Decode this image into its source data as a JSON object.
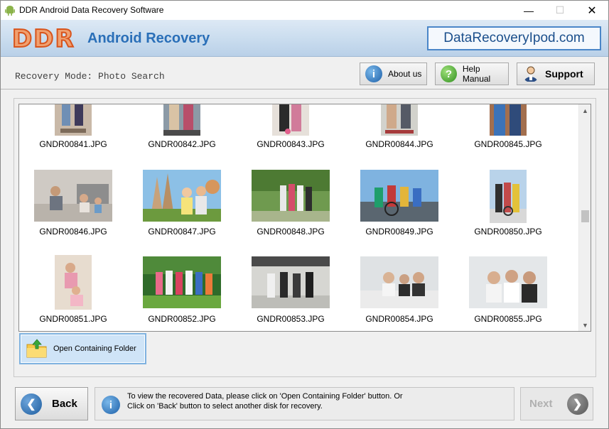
{
  "window": {
    "title": "DDR Android Data Recovery Software",
    "minimize": "—",
    "maximize": "☐",
    "close": "✕"
  },
  "banner": {
    "logo": "DDR",
    "app_name": "Android Recovery",
    "website": "DataRecoveryIpod.com"
  },
  "toolbar": {
    "mode_label": "Recovery Mode: Photo Search",
    "about_label": "About us",
    "help_label": "Help Manual",
    "support_label": "Support"
  },
  "gallery": {
    "rows": [
      [
        "GNDR00841.JPG",
        "GNDR00842.JPG",
        "GNDR00843.JPG",
        "GNDR00844.JPG",
        "GNDR00845.JPG"
      ],
      [
        "GNDR00846.JPG",
        "GNDR00847.JPG",
        "GNDR00848.JPG",
        "GNDR00849.JPG",
        "GNDR00850.JPG"
      ],
      [
        "GNDR00851.JPG",
        "GNDR00852.JPG",
        "GNDR00853.JPG",
        "GNDR00854.JPG",
        "GNDR00855.JPG"
      ]
    ]
  },
  "actions": {
    "open_folder_label": "Open Containing Folder",
    "back_label": "Back",
    "next_label": "Next",
    "info_line1": "To view the recovered Data, please click on 'Open Containing Folder' button. Or",
    "info_line2": "Click on 'Back' button to select another disk for recovery."
  },
  "icons": {
    "app": "android-icon",
    "about": "info-icon",
    "help": "question-icon",
    "support": "person-icon",
    "folder": "folder-icon",
    "back": "left-arrow-icon",
    "next": "right-arrow-icon"
  },
  "colors": {
    "logo_orange": "#d8541c",
    "brand_blue": "#2a6fb8",
    "selection_blue": "#cfe4f7"
  }
}
